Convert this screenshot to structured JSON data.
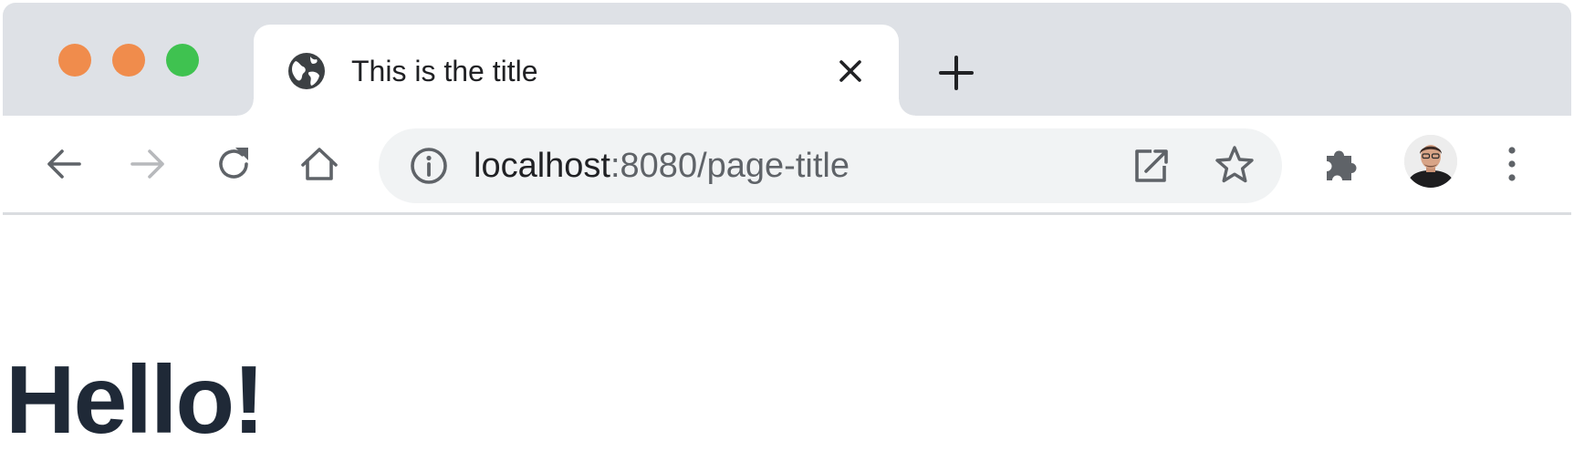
{
  "browser": {
    "tab": {
      "title": "This is the title",
      "favicon": "globe-icon"
    },
    "address_bar": {
      "host": "localhost",
      "port_and_path": ":8080/page-title"
    },
    "colors": {
      "traffic_close": "#f08c4c",
      "traffic_minimize": "#f08c4c",
      "traffic_zoom": "#3fc250",
      "tab_strip": "#dee1e6",
      "omnibox": "#f1f3f4"
    },
    "icons": {
      "back": "arrow-left-icon",
      "forward": "arrow-right-icon",
      "reload": "reload-icon",
      "home": "home-icon",
      "site_info": "info-icon",
      "open_in_app": "open-external-icon",
      "bookmark": "star-icon",
      "extensions": "puzzle-icon",
      "menu": "kebab-menu-icon",
      "new_tab": "plus-icon",
      "close_tab": "close-icon"
    }
  },
  "page": {
    "heading": "Hello!"
  }
}
